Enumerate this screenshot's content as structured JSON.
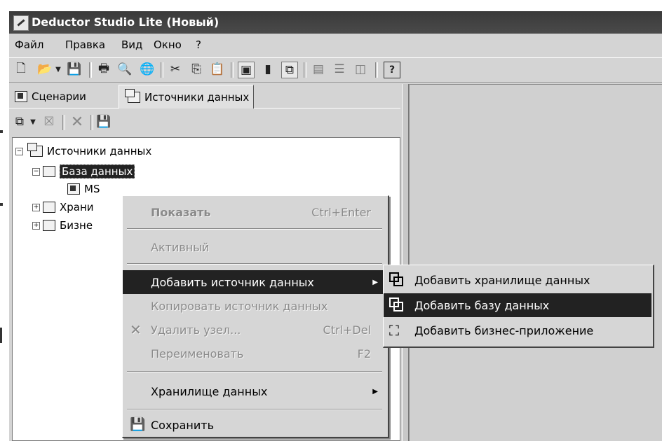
{
  "window": {
    "title": "Deductor Studio Lite (Новый)"
  },
  "menubar": [
    "Файл",
    "Правка",
    "Вид",
    "Окно",
    "?"
  ],
  "toolbar_icons": [
    "new-file-icon",
    "open-icon",
    "dropdown-arrow-icon",
    "save-icon",
    "print-icon",
    "print-preview-icon",
    "globe-icon",
    "cut-icon",
    "copy-icon",
    "paste-icon",
    "scenarios-icon",
    "book-icon",
    "datasources-icon",
    "window-icon-1",
    "window-icon-2",
    "window-icon-3",
    "help-icon"
  ],
  "tabs": [
    {
      "label": "Сценарии",
      "icon": "scenarios-icon"
    },
    {
      "label": "Источники данных",
      "icon": "datasources-icon"
    }
  ],
  "tree": {
    "root": "Источники данных",
    "items": [
      {
        "label": "База данных",
        "expanded": true,
        "selected": true
      },
      {
        "label": "MS",
        "child": true
      },
      {
        "label": "Храни"
      },
      {
        "label": "Бизне"
      }
    ]
  },
  "context_menu": {
    "items": [
      {
        "label": "Показать",
        "shortcut": "Ctrl+Enter",
        "disabled": true,
        "bold": true
      },
      {
        "label": "Активный",
        "disabled": true
      },
      {
        "label": "Добавить источник данных",
        "submenu": true,
        "highlighted": true
      },
      {
        "label": "Копировать источник данных",
        "disabled": true
      },
      {
        "label": "Удалить узел...",
        "shortcut": "Ctrl+Del",
        "disabled": true,
        "icon": "delete-icon"
      },
      {
        "label": "Переименовать",
        "shortcut": "F2",
        "disabled": true
      },
      {
        "label": "Хранилище данных",
        "submenu": true
      },
      {
        "label": "Сохранить",
        "icon": "save-icon"
      }
    ]
  },
  "submenu": {
    "items": [
      {
        "label": "Добавить хранилище данных",
        "icon": "warehouse-icon"
      },
      {
        "label": "Добавить базу данных",
        "icon": "database-icon",
        "highlighted": true
      },
      {
        "label": "Добавить бизнес-приложение",
        "icon": "business-app-icon"
      }
    ]
  },
  "colors": {
    "highlight": "#222222",
    "disabled_text": "#8a8a8a",
    "face": "#d4d4d4"
  }
}
